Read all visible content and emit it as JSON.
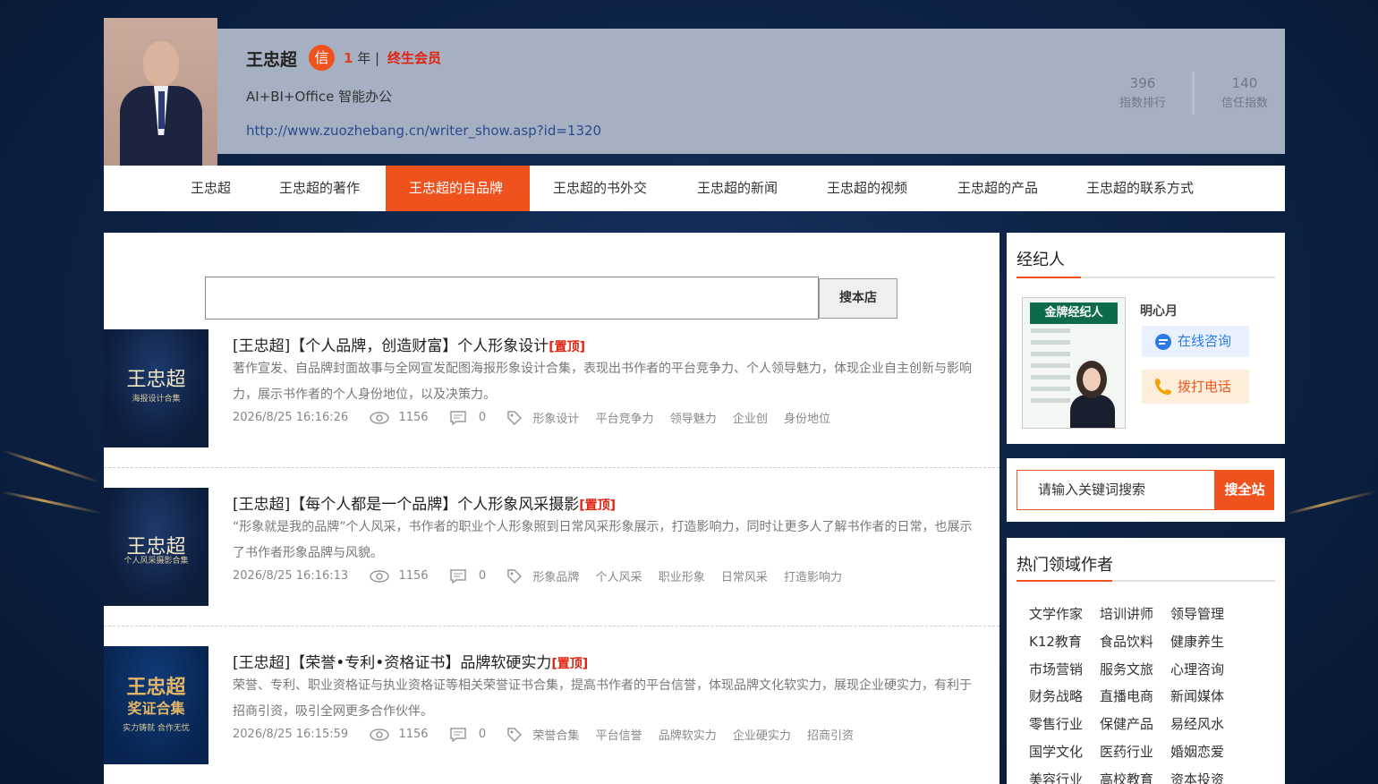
{
  "profile": {
    "name": "王忠超",
    "badge": "信",
    "years_num": "1",
    "years_suffix": "年 |",
    "member": "终生会员",
    "slogan": "AI+BI+Office 智能办公",
    "url": "http://www.zuozhebang.cn/writer_show.asp?id=1320",
    "stats": [
      {
        "value": "396",
        "label": "指数排行"
      },
      {
        "value": "140",
        "label": "信任指数"
      }
    ]
  },
  "nav": {
    "items": [
      "王忠超",
      "王忠超的著作",
      "王忠超的自品牌",
      "王忠超的书外交",
      "王忠超的新闻",
      "王忠超的视频",
      "王忠超的产品",
      "王忠超的联系方式"
    ],
    "active_index": 2
  },
  "store_search": {
    "value": "",
    "button": "搜本店"
  },
  "articles": [
    {
      "title": "[王忠超]【个人品牌，创造财富】个人形象设计",
      "top": "[置顶]",
      "desc": "著作宣发、自品牌封面故事与全网宣发配图海报形象设计合集，表现出书作者的平台竞争力、个人领导魅力，体现企业自主创新与影响力，展示书作者的个人身份地位，以及决策力。",
      "date": "2026/8/25 16:16:26",
      "views": "1156",
      "comments": "0",
      "tags": [
        "形象设计",
        "平台竞争力",
        "领导魅力",
        "企业创",
        "身份地位"
      ],
      "thumb_title": "王忠超",
      "thumb_sub": "海报设计合集"
    },
    {
      "title": "[王忠超]【每个人都是一个品牌】个人形象风采摄影",
      "top": "[置顶]",
      "desc": "“形象就是我的品牌”个人风采，书作者的职业个人形象照到日常风采形象展示，打造影响力，同时让更多人了解书作者的日常，也展示了书作者形象品牌与风貌。",
      "date": "2026/8/25 16:16:13",
      "views": "1156",
      "comments": "0",
      "tags": [
        "形象品牌",
        "个人风采",
        "职业形象",
        "日常风采",
        "打造影响力"
      ],
      "thumb_title": "王忠超",
      "thumb_sub": "个人风采摄影合集"
    },
    {
      "title": "[王忠超]【荣誉•专利•资格证书】品牌软硬实力",
      "top": "[置顶]",
      "desc": "荣誉、专利、职业资格证与执业资格证等相关荣誉证书合集，提高书作者的平台信誉，体现品牌文化软实力，展现企业硬实力，有利于招商引资，吸引全网更多合作伙伴。",
      "date": "2026/8/25 16:15:59",
      "views": "1156",
      "comments": "0",
      "tags": [
        "荣誉合集",
        "平台信誉",
        "品牌软实力",
        "企业硬实力",
        "招商引资"
      ],
      "thumb_title": "王忠超",
      "thumb_sub": "奖证合集",
      "thumb_sub2": "实力铸就 合作无忧"
    }
  ],
  "agent": {
    "title": "经纪人",
    "name": "明心月",
    "image_header": "金牌经纪人",
    "consult": "在线咨询",
    "call": "拨打电话"
  },
  "site_search": {
    "placeholder": "请输入关键词搜索",
    "button": "搜全站"
  },
  "hot": {
    "title": "热门领域作者",
    "items": [
      "文学作家",
      "培训讲师",
      "领导管理",
      "K12教育",
      "食品饮料",
      "健康养生",
      "市场营销",
      "服务文旅",
      "心理咨询",
      "财务战略",
      "直播电商",
      "新闻媒体",
      "零售行业",
      "保健产品",
      "易经风水",
      "国学文化",
      "医药行业",
      "婚姻恋爱",
      "美容行业",
      "高校教育",
      "资本投资"
    ]
  },
  "colors": {
    "accent": "#f0521e",
    "top_red": "#e0220e",
    "bg_navy": "#0d2347"
  }
}
